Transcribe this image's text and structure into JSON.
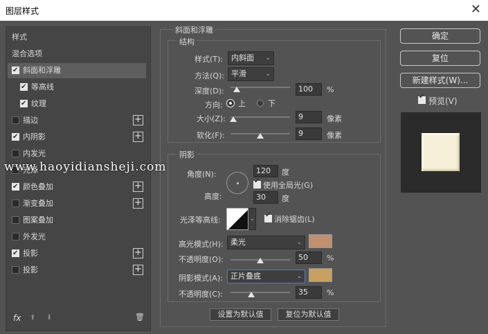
{
  "window": {
    "title": "图层样式",
    "close": "✕"
  },
  "sidebar": {
    "items": [
      {
        "label": "样式",
        "check": null,
        "plus": false,
        "selected": false
      },
      {
        "label": "混合选项",
        "check": null,
        "plus": false,
        "selected": false
      },
      {
        "label": "斜面和浮雕",
        "check": true,
        "plus": false,
        "selected": true
      },
      {
        "label": "等高线",
        "check": true,
        "plus": false,
        "selected": false,
        "indent": true
      },
      {
        "label": "纹理",
        "check": true,
        "plus": false,
        "selected": false,
        "indent": true
      },
      {
        "label": "描边",
        "check": false,
        "plus": true,
        "selected": false
      },
      {
        "label": "内阴影",
        "check": true,
        "plus": true,
        "selected": false
      },
      {
        "label": "内发光",
        "check": false,
        "plus": false,
        "selected": false
      },
      {
        "label": "光泽",
        "check": false,
        "plus": false,
        "selected": false
      },
      {
        "label": "颜色叠加",
        "check": true,
        "plus": true,
        "selected": false
      },
      {
        "label": "渐变叠加",
        "check": false,
        "plus": true,
        "selected": false
      },
      {
        "label": "图案叠加",
        "check": false,
        "plus": false,
        "selected": false
      },
      {
        "label": "外发光",
        "check": false,
        "plus": false,
        "selected": false
      },
      {
        "label": "投影",
        "check": true,
        "plus": true,
        "selected": false
      },
      {
        "label": "投影",
        "check": false,
        "plus": true,
        "selected": false
      }
    ],
    "fx": "fx",
    "up": "⬆",
    "down": "⬇",
    "trash": "🗑"
  },
  "bevel": {
    "section_title": "斜面和浮雕",
    "structure_title": "结构",
    "style_label": "样式(T):",
    "style_value": "内斜面",
    "method_label": "方法(Q):",
    "method_value": "平滑",
    "depth_label": "深度(D):",
    "depth_value": "100",
    "depth_unit": "%",
    "depth_level": 0.1,
    "direction_label": "方向:",
    "dir_up": "上",
    "dir_down": "下",
    "size_label": "大小(Z):",
    "size_value": "9",
    "size_unit": "像素",
    "size_level": 0.05,
    "soften_label": "软化(F):",
    "soften_value": "9",
    "soften_unit": "像素",
    "soften_level": 0.5
  },
  "shading": {
    "title": "阴影",
    "angle_label": "角度(N):",
    "angle_value": "120",
    "angle_unit": "度",
    "global_light": "使用全局光(G)",
    "altitude_label": "高度:",
    "altitude_value": "30",
    "altitude_unit": "度",
    "gloss_label": "光泽等高线:",
    "antialias": "消除锯齿(L)",
    "highlight_label": "高光模式(H):",
    "highlight_mode": "柔光",
    "highlight_color": "#c09070",
    "hl_opacity_label": "不透明度(O):",
    "hl_opacity_value": "50",
    "hl_opacity_level": 0.5,
    "shadow_label": "阴影模式(A):",
    "shadow_mode": "正片叠底",
    "shadow_color": "#c8a060",
    "sh_opacity_label": "不透明度(C):",
    "sh_opacity_value": "35",
    "sh_opacity_level": 0.35,
    "percent": "%",
    "make_default": "设置为默认值",
    "reset_default": "复位为默认值"
  },
  "actions": {
    "ok": "确定",
    "reset": "复位",
    "new_style": "新建样式(W)...",
    "preview": "预览(V)"
  },
  "watermark": "www.haoyidiansheji.com"
}
